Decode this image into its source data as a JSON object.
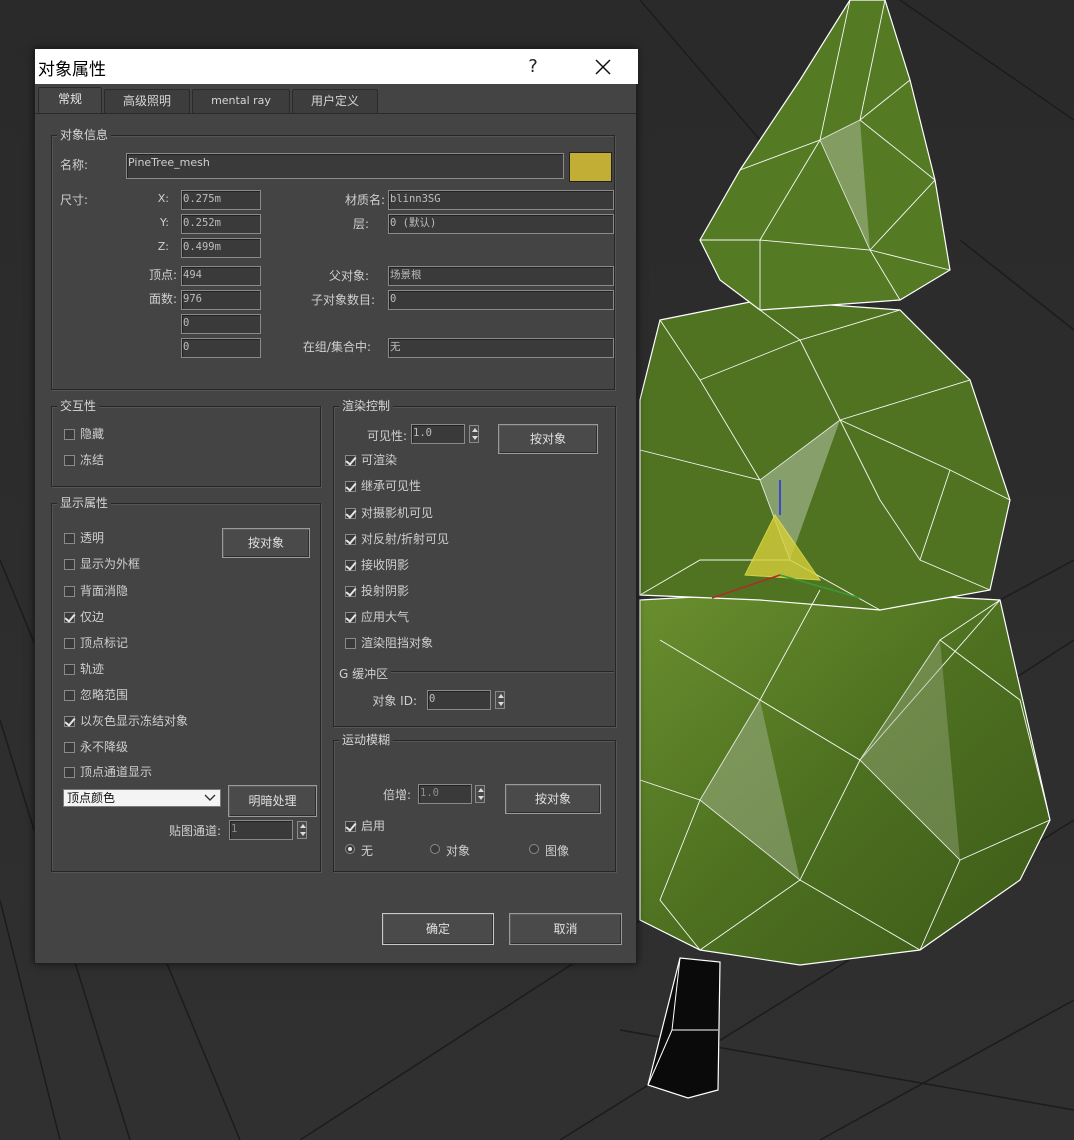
{
  "dialog": {
    "title": "对象属性",
    "help_label": "?",
    "tabs": [
      "常规",
      "高级照明",
      "mental ray",
      "用户定义"
    ],
    "ok_label": "确定",
    "cancel_label": "取消"
  },
  "object_info": {
    "title": "对象信息",
    "name_label": "名称:",
    "name_value": "PineTree_mesh",
    "color": "#c3ae35",
    "dimensions_label": "尺寸:",
    "x_label": "X:",
    "x_value": "0.275m",
    "y_label": "Y:",
    "y_value": "0.252m",
    "z_label": "Z:",
    "z_value": "0.499m",
    "vertices_label": "顶点:",
    "vertices_value": "494",
    "faces_label": "面数:",
    "faces_value": "976",
    "extra1_value": "0",
    "extra2_value": "0",
    "material_label": "材质名:",
    "material_value": "blinn3SG",
    "layer_label": "层:",
    "layer_value": "0 (默认)",
    "parent_label": "父对象:",
    "parent_value": "场景根",
    "children_label": "子对象数目:",
    "children_value": "0",
    "group_label": "在组/集合中:",
    "group_value": "无"
  },
  "interactivity": {
    "title": "交互性",
    "hide_label": "隐藏",
    "hide_checked": false,
    "freeze_label": "冻结",
    "freeze_checked": false
  },
  "display": {
    "title": "显示属性",
    "by_object_label": "按对象",
    "items": [
      {
        "label": "透明",
        "checked": false
      },
      {
        "label": "显示为外框",
        "checked": false
      },
      {
        "label": "背面消隐",
        "checked": false
      },
      {
        "label": "仅边",
        "checked": true
      },
      {
        "label": "顶点标记",
        "checked": false
      },
      {
        "label": "轨迹",
        "checked": false
      },
      {
        "label": "忽略范围",
        "checked": false
      },
      {
        "label": "以灰色显示冻结对象",
        "checked": true
      },
      {
        "label": "永不降级",
        "checked": false
      },
      {
        "label": "顶点通道显示",
        "checked": false
      }
    ],
    "channel_select": "顶点颜色",
    "shading_label": "明暗处理",
    "map_channel_label": "贴图通道:",
    "map_channel_value": "1"
  },
  "render": {
    "title": "渲染控制",
    "visibility_label": "可见性:",
    "visibility_value": "1.0",
    "by_object_label": "按对象",
    "items": [
      {
        "label": "可渲染",
        "checked": true
      },
      {
        "label": "继承可见性",
        "checked": true
      },
      {
        "label": "对摄影机可见",
        "checked": true
      },
      {
        "label": "对反射/折射可见",
        "checked": true
      },
      {
        "label": "接收阴影",
        "checked": true
      },
      {
        "label": "投射阴影",
        "checked": true
      },
      {
        "label": "应用大气",
        "checked": true
      },
      {
        "label": "渲染阻挡对象",
        "checked": false
      }
    ],
    "gbuffer_title": "G 缓冲区",
    "object_id_label": "对象 ID:",
    "object_id_value": "0"
  },
  "motion_blur": {
    "title": "运动模糊",
    "multiplier_label": "倍增:",
    "multiplier_value": "1.0",
    "by_object_label": "按对象",
    "enable_label": "启用",
    "enable_checked": true,
    "options": [
      "无",
      "对象",
      "图像"
    ],
    "selected": 0
  }
}
